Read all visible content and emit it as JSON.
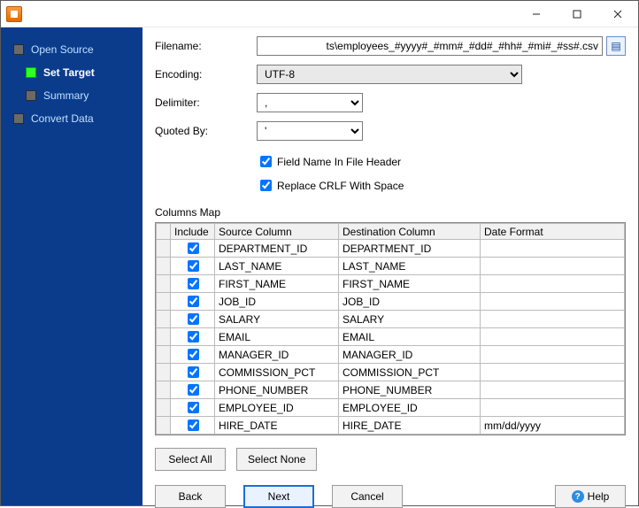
{
  "titlebar": {
    "title": ""
  },
  "sidebar": {
    "items": [
      {
        "label": "Open Source",
        "active": false
      },
      {
        "label": "Set Target",
        "active": true
      },
      {
        "label": "Summary",
        "active": false
      },
      {
        "label": "Convert Data",
        "active": false
      }
    ]
  },
  "form": {
    "filename_label": "Filename:",
    "filename_value": "ts\\employees_#yyyy#_#mm#_#dd#_#hh#_#mi#_#ss#.csv",
    "encoding_label": "Encoding:",
    "encoding_value": "UTF-8",
    "delimiter_label": "Delimiter:",
    "delimiter_value": ",",
    "quoted_label": "Quoted By:",
    "quoted_value": "'",
    "field_header_label": "Field Name In File Header",
    "field_header_checked": true,
    "replace_crlf_label": "Replace CRLF With Space",
    "replace_crlf_checked": true
  },
  "columns_map": {
    "title": "Columns Map",
    "headers": {
      "include": "Include",
      "source": "Source Column",
      "destination": "Destination Column",
      "date_format": "Date Format"
    },
    "rows": [
      {
        "include": true,
        "source": "DEPARTMENT_ID",
        "destination": "DEPARTMENT_ID",
        "date_format": ""
      },
      {
        "include": true,
        "source": "LAST_NAME",
        "destination": "LAST_NAME",
        "date_format": ""
      },
      {
        "include": true,
        "source": "FIRST_NAME",
        "destination": "FIRST_NAME",
        "date_format": ""
      },
      {
        "include": true,
        "source": "JOB_ID",
        "destination": "JOB_ID",
        "date_format": ""
      },
      {
        "include": true,
        "source": "SALARY",
        "destination": "SALARY",
        "date_format": ""
      },
      {
        "include": true,
        "source": "EMAIL",
        "destination": "EMAIL",
        "date_format": ""
      },
      {
        "include": true,
        "source": "MANAGER_ID",
        "destination": "MANAGER_ID",
        "date_format": ""
      },
      {
        "include": true,
        "source": "COMMISSION_PCT",
        "destination": "COMMISSION_PCT",
        "date_format": ""
      },
      {
        "include": true,
        "source": "PHONE_NUMBER",
        "destination": "PHONE_NUMBER",
        "date_format": ""
      },
      {
        "include": true,
        "source": "EMPLOYEE_ID",
        "destination": "EMPLOYEE_ID",
        "date_format": ""
      },
      {
        "include": true,
        "source": "HIRE_DATE",
        "destination": "HIRE_DATE",
        "date_format": "mm/dd/yyyy"
      }
    ]
  },
  "buttons": {
    "select_all": "Select All",
    "select_none": "Select None",
    "back": "Back",
    "next": "Next",
    "cancel": "Cancel",
    "help": "Help"
  }
}
